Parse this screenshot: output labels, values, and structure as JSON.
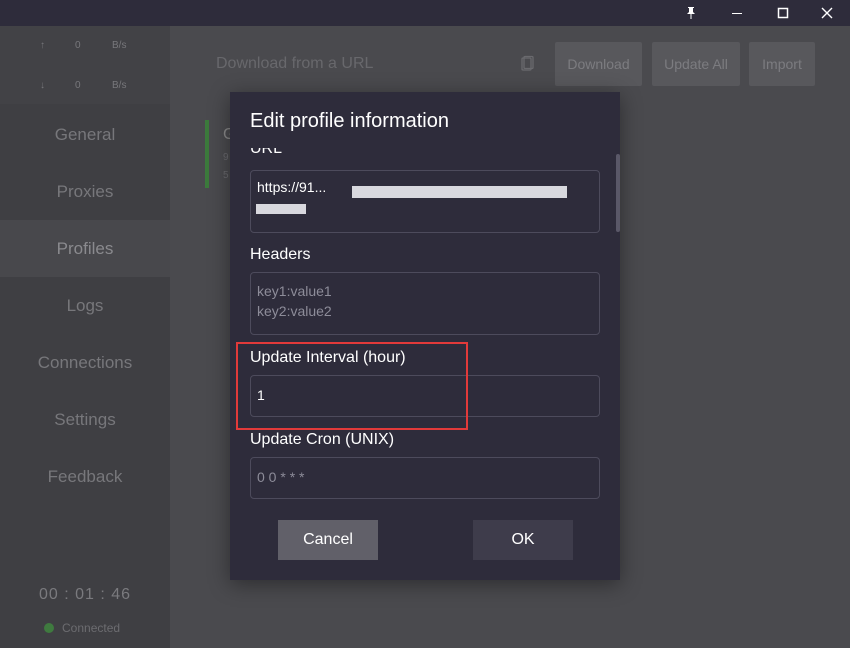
{
  "titlebar": {
    "pin_icon": "pin-icon",
    "minimize_icon": "minimize-icon",
    "maximize_icon": "maximize-icon",
    "close_icon": "close-icon"
  },
  "sidebar": {
    "traffic": {
      "up": {
        "arrow": "↑",
        "value": "0",
        "unit": "B/s"
      },
      "down": {
        "arrow": "↓",
        "value": "0",
        "unit": "B/s"
      }
    },
    "items": [
      {
        "label": "General"
      },
      {
        "label": "Proxies"
      },
      {
        "label": "Profiles",
        "active": true
      },
      {
        "label": "Logs"
      },
      {
        "label": "Connections"
      },
      {
        "label": "Settings"
      },
      {
        "label": "Feedback"
      }
    ],
    "timer": "00 : 01 : 46",
    "status": "Connected"
  },
  "main": {
    "url_placeholder": "Download from a URL",
    "buttons": {
      "download": "Download",
      "update_all": "Update All",
      "import": "Import"
    },
    "card_letter": "G",
    "card_sub1": "9",
    "card_sub2": "5"
  },
  "dialog": {
    "title": "Edit profile information",
    "fields": {
      "url_label": "URL",
      "url_value_line1": "https://91...",
      "headers_label": "Headers",
      "headers_line1": "key1:value1",
      "headers_line2": "key2:value2",
      "interval_label": "Update Interval (hour)",
      "interval_value": "1",
      "cron_label": "Update Cron (UNIX)",
      "cron_placeholder": "0 0 * * *"
    },
    "cancel": "Cancel",
    "ok": "OK"
  },
  "colors": {
    "dialog_bg": "#2e2c3b",
    "highlight": "#e23a3a",
    "connected": "#3f7a3f"
  }
}
